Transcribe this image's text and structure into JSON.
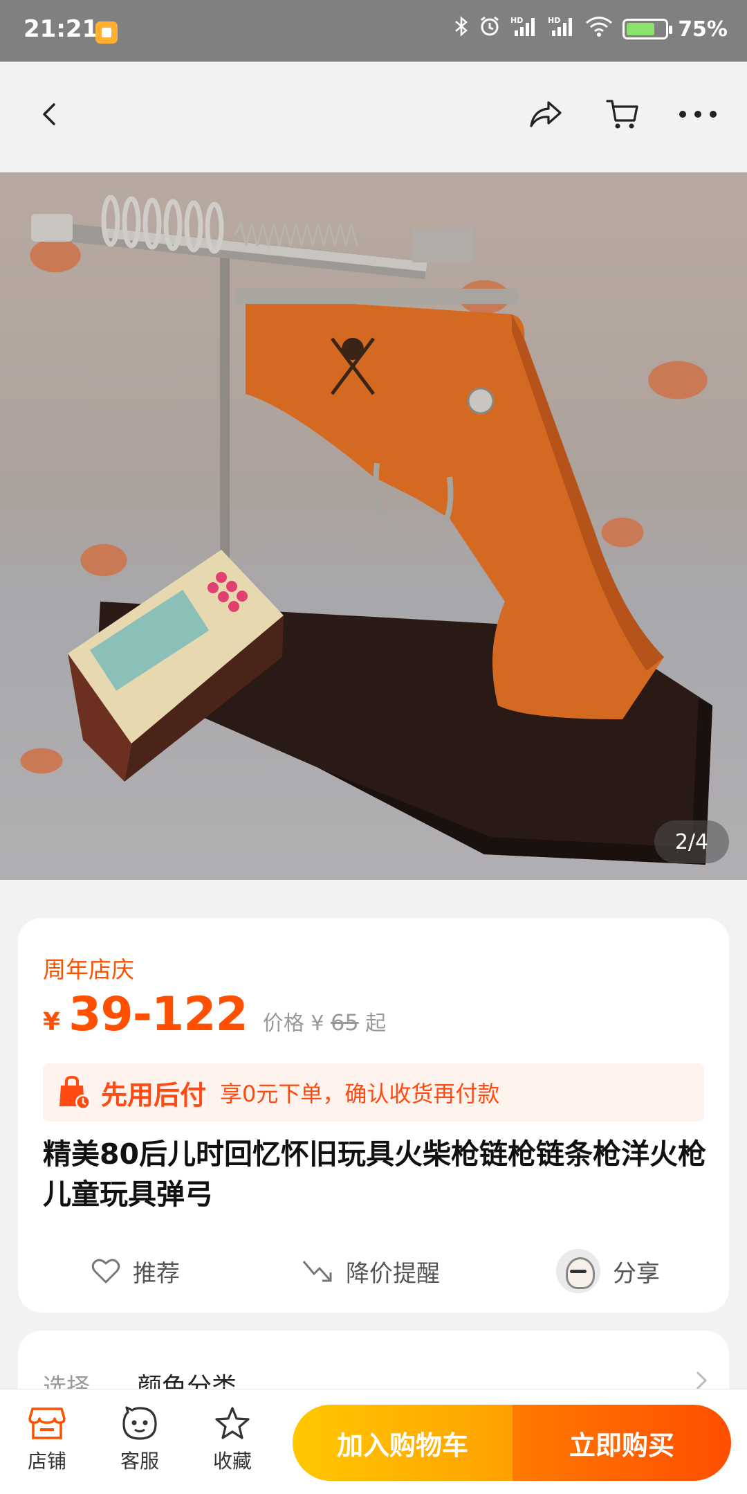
{
  "status_bar": {
    "time": "21:21",
    "battery": "75%",
    "icons": [
      "app-notification-icon",
      "bluetooth-icon",
      "alarm-icon",
      "signal-hd-icon",
      "signal-hd-icon",
      "wifi-icon",
      "battery-charging-icon"
    ],
    "signal_label": "HD"
  },
  "nav": {
    "icons": [
      "back-icon",
      "share-icon",
      "cart-icon",
      "more-icon"
    ]
  },
  "gallery": {
    "indicator": "2/4"
  },
  "product": {
    "promo_tag": "周年店庆",
    "currency": "¥",
    "price": "39-122",
    "orig_prefix": "价格 ¥",
    "orig_price": "65",
    "orig_suffix": "起",
    "pay_later_title": "先用后付",
    "pay_later_desc": "享0元下单，确认收货再付款",
    "title": "精美80后儿时回忆怀旧玩具火柴枪链枪链条枪洋火枪儿童玩具弹弓"
  },
  "actions": {
    "recommend": "推荐",
    "price_alert": "降价提醒",
    "share": "分享"
  },
  "select": {
    "label": "选择",
    "value": "颜色分类"
  },
  "bottom_bar": {
    "store": "店铺",
    "service": "客服",
    "favorite": "收藏",
    "add_to_cart": "加入购物车",
    "buy_now": "立即购买"
  },
  "colors": {
    "accent": "#ff5000",
    "cart_button": "#ffb400",
    "buy_button": "#ff5a00",
    "status_bar": "#808080"
  }
}
